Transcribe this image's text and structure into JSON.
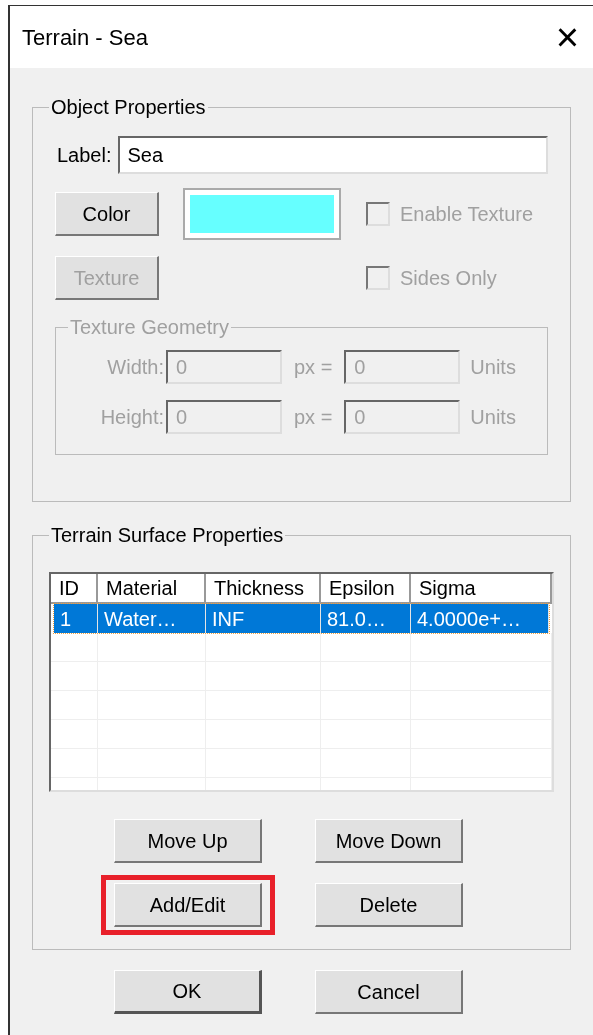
{
  "window": {
    "title": "Terrain - Sea",
    "close": "×"
  },
  "object_properties": {
    "title": "Object Properties",
    "label": {
      "caption": "Label:",
      "value": "Sea"
    },
    "color_button": {
      "label": "Color",
      "disabled": false
    },
    "swatch": {
      "color": "#66ffff"
    },
    "texture_button": {
      "label": "Texture",
      "disabled": true
    },
    "checkboxes": [
      {
        "label": "Enable Texture",
        "checked": false,
        "disabled": true
      },
      {
        "label": "Sides Only",
        "checked": false,
        "disabled": true
      }
    ],
    "texture_geometry": {
      "title": "Texture Geometry",
      "disabled": true,
      "rows": [
        {
          "caption": "Width:",
          "px_value": "0",
          "px_label": "px =",
          "units_value": "0",
          "units_label": "Units"
        },
        {
          "caption": "Height:",
          "px_value": "0",
          "px_label": "px =",
          "units_value": "0",
          "units_label": "Units"
        }
      ]
    }
  },
  "surface_properties": {
    "title": "Terrain Surface Properties",
    "table": {
      "columns": [
        "ID",
        "Material",
        "Thickness",
        "Epsilon",
        "Sigma"
      ],
      "rows": [
        {
          "cells": [
            "1",
            "Water…",
            "INF",
            "81.0…",
            "4.0000e+…"
          ],
          "selected": true
        }
      ]
    },
    "buttons": [
      {
        "label": "Move Up"
      },
      {
        "label": "Move Down"
      },
      {
        "label": "Add/Edit",
        "highlighted": true
      },
      {
        "label": "Delete"
      }
    ]
  },
  "footer_buttons": [
    {
      "label": "OK",
      "default": true
    },
    {
      "label": "Cancel",
      "default": false
    }
  ]
}
